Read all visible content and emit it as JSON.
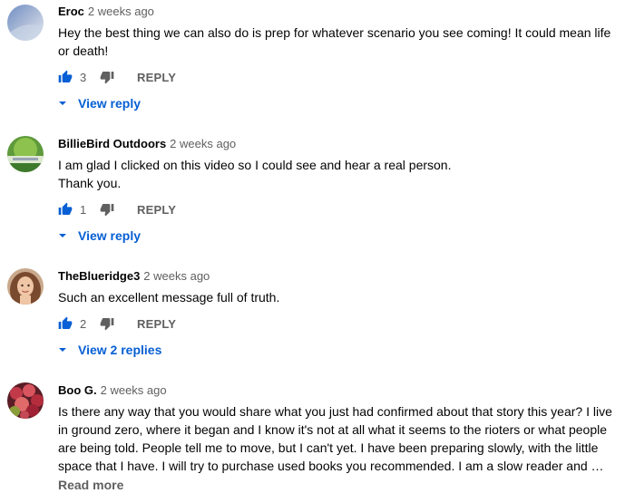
{
  "comments": [
    {
      "author": "Eroc",
      "time": "2 weeks ago",
      "text_lines": [
        "Hey the best thing we can also do is prep for whatever scenario you see coming! It could mean life",
        "or death!"
      ],
      "likes": "3",
      "reply_label": "REPLY",
      "view_replies": "View reply"
    },
    {
      "author": "BillieBird Outdoors",
      "time": "2 weeks ago",
      "text_lines": [
        "I am glad I clicked on this video so I could see and hear a real person.",
        "Thank you."
      ],
      "likes": "1",
      "reply_label": "REPLY",
      "view_replies": "View reply"
    },
    {
      "author": "TheBlueridge3",
      "time": "2 weeks ago",
      "text_lines": [
        "Such an excellent message full of truth."
      ],
      "likes": "2",
      "reply_label": "REPLY",
      "view_replies": "View 2 replies"
    },
    {
      "author": "Boo G.",
      "time": "2 weeks ago",
      "text_lines": [
        "Is there any way that you would share what you just had confirmed about that story this year?  I live",
        "in ground zero, where it began and I know it's not at all what it seems to the rioters or what people",
        "are being told. People tell me to move, but I can't yet.  I have been preparing slowly, with the little",
        "space that I have.  I will try to purchase used books you recommended.  I am a slow reader and …"
      ],
      "read_more": "Read more"
    }
  ],
  "colors": {
    "link_blue": "#065fd4",
    "like_active": "#065fd4",
    "muted": "#606060"
  }
}
